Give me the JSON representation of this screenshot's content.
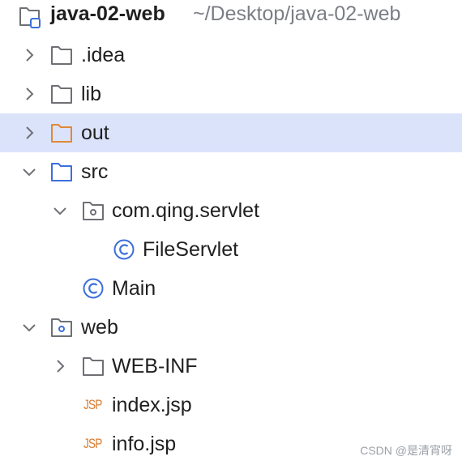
{
  "project": {
    "name": "java-02-web",
    "path": "~/Desktop/java-02-web"
  },
  "tree": {
    "items": [
      {
        "label": ".idea",
        "icon": "folder-icon"
      },
      {
        "label": "lib",
        "icon": "folder-icon"
      },
      {
        "label": "out",
        "icon": "excluded-folder-icon",
        "selected": true
      },
      {
        "label": "src",
        "icon": "source-folder-icon"
      },
      {
        "label": "com.qing.servlet",
        "icon": "package-icon"
      },
      {
        "label": "FileServlet",
        "icon": "java-class-icon"
      },
      {
        "label": "Main",
        "icon": "java-class-icon"
      },
      {
        "label": "web",
        "icon": "web-folder-icon"
      },
      {
        "label": "WEB-INF",
        "icon": "folder-icon"
      },
      {
        "label": "index.jsp",
        "icon": "jsp-file-icon",
        "badge": "JSP"
      },
      {
        "label": "info.jsp",
        "icon": "jsp-file-icon",
        "badge": "JSP"
      }
    ]
  },
  "watermark": "CSDN @是清宵呀",
  "colors": {
    "selection": "#dbe3fb",
    "folder_stroke": "#6e7075",
    "excluded_folder": "#e0883a",
    "source_folder": "#3d6fdb",
    "class_icon": "#3d6fdb",
    "jsp_badge": "#d97a2c"
  }
}
